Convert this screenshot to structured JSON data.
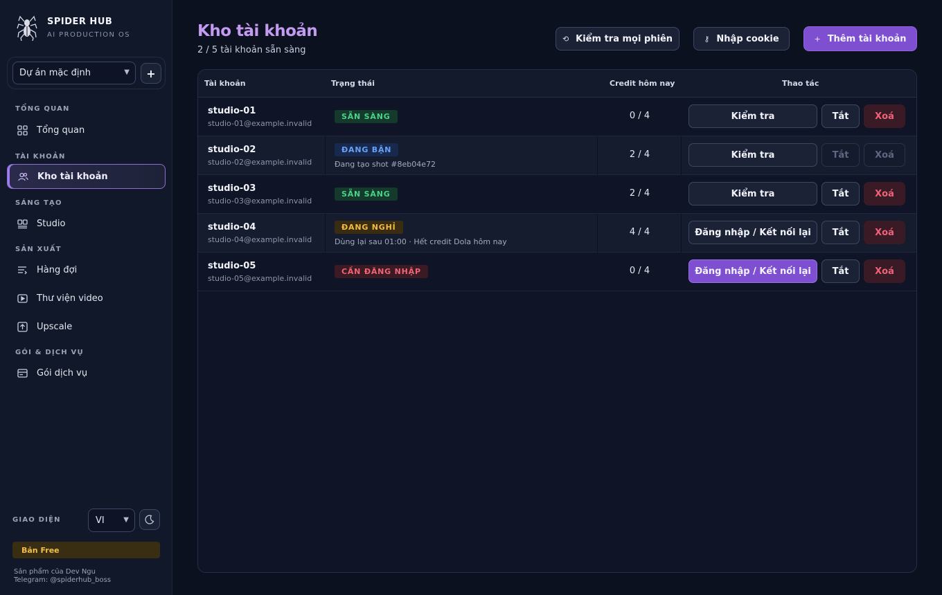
{
  "brand": {
    "name": "SPIDER HUB",
    "tagline": "AI PRODUCTION OS"
  },
  "project": {
    "selected": "Dự án mặc định",
    "add_label": "+"
  },
  "nav": {
    "sections": {
      "overview": "TỔNG QUAN",
      "accounts": "TÀI KHOẢN",
      "create": "SÁNG TẠO",
      "production": "SẢN XUẤT",
      "plans": "GÓI & DỊCH VỤ"
    },
    "items": {
      "overview": "Tổng quan",
      "accounts": "Kho tài khoản",
      "studio": "Studio",
      "queue": "Hàng đợi",
      "library": "Thư viện video",
      "upscale": "Upscale",
      "plans": "Gói dịch vụ"
    }
  },
  "footer": {
    "theme_label": "GIAO DIỆN",
    "language": "VI",
    "plan_badge": "Bản Free",
    "credit_line1": "Sản phẩm của Dev Ngu",
    "credit_line2": "Telegram: @spiderhub_boss"
  },
  "header": {
    "title": "Kho tài khoản",
    "subtitle": "2 / 5 tài khoản sẵn sàng",
    "check_all": "Kiểm tra mọi phiên",
    "import_cookie": "Nhập cookie",
    "add_account": "Thêm tài khoản"
  },
  "table": {
    "columns": {
      "account": "Tài khoản",
      "status": "Trạng thái",
      "credit": "Credit hôm nay",
      "actions": "Thao tác"
    },
    "rows": [
      {
        "name": "studio-01",
        "email": "studio-01@example.invalid",
        "status": "SẴN SÀNG",
        "note": "",
        "credit": "0 / 4",
        "action": "Kiểm tra",
        "off": "Tắt",
        "delete": "Xoá"
      },
      {
        "name": "studio-02",
        "email": "studio-02@example.invalid",
        "status": "ĐANG BẬN",
        "note": "Đang tạo shot #8eb04e72",
        "credit": "2 / 4",
        "action": "Kiểm tra",
        "off": "Tắt",
        "delete": "Xoá"
      },
      {
        "name": "studio-03",
        "email": "studio-03@example.invalid",
        "status": "SẴN SÀNG",
        "note": "",
        "credit": "2 / 4",
        "action": "Kiểm tra",
        "off": "Tắt",
        "delete": "Xoá"
      },
      {
        "name": "studio-04",
        "email": "studio-04@example.invalid",
        "status": "ĐANG NGHỈ",
        "note": "Dùng lại sau 01:00 · Hết credit Dola hôm nay",
        "credit": "4 / 4",
        "action": "Đăng nhập / Kết nối lại",
        "off": "Tắt",
        "delete": "Xoá"
      },
      {
        "name": "studio-05",
        "email": "studio-05@example.invalid",
        "status": "CẦN ĐĂNG NHẬP",
        "note": "",
        "credit": "0 / 4",
        "action": "Đăng nhập / Kết nối lại",
        "off": "Tắt",
        "delete": "Xoá"
      }
    ]
  },
  "colors": {
    "accent": "#7e4fd0",
    "title": "#c39cf0",
    "ready": "#4ed08a",
    "busy": "#6aa1f4",
    "rest": "#f2bb44",
    "login": "#ee6677"
  }
}
